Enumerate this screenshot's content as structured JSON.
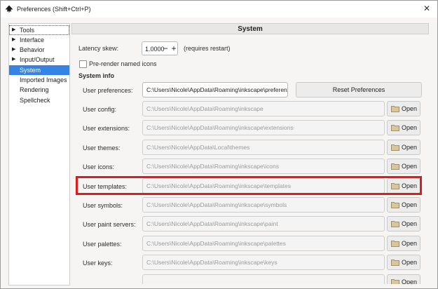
{
  "window": {
    "title": "Preferences (Shift+Ctrl+P)",
    "close": "✕"
  },
  "sidebar": {
    "items": [
      {
        "label": "Tools",
        "expandable": true
      },
      {
        "label": "Interface",
        "expandable": true
      },
      {
        "label": "Behavior",
        "expandable": true
      },
      {
        "label": "Input/Output",
        "expandable": true
      },
      {
        "label": "System",
        "expandable": false,
        "selected": true
      },
      {
        "label": "Imported Images",
        "expandable": false
      },
      {
        "label": "Rendering",
        "expandable": false
      },
      {
        "label": "Spellcheck",
        "expandable": false
      }
    ]
  },
  "panel": {
    "title": "System",
    "latency": {
      "label": "Latency skew:",
      "value": "1.0000",
      "minus": "−",
      "plus": "+",
      "note": "(requires restart)"
    },
    "prerender": {
      "label": "Pre-render named icons",
      "checked": false
    },
    "section_title": "System info",
    "user_preferences": {
      "label": "User preferences:",
      "value": "C:\\Users\\Nicole\\AppData\\Roaming\\inkscape\\preferen",
      "reset_label": "Reset Preferences"
    },
    "open_label": "Open",
    "rows": [
      {
        "label": "User config:",
        "value": "C:\\Users\\Nicole\\AppData\\Roaming\\inkscape"
      },
      {
        "label": "User extensions:",
        "value": "C:\\Users\\Nicole\\AppData\\Roaming\\inkscape\\extensions"
      },
      {
        "label": "User themes:",
        "value": "C:\\Users\\Nicole\\AppData\\Local\\themes"
      },
      {
        "label": "User icons:",
        "value": "C:\\Users\\Nicole\\AppData\\Roaming\\inkscape\\icons"
      },
      {
        "label": "User templates:",
        "value": "C:\\Users\\Nicole\\AppData\\Roaming\\inkscape\\templates"
      },
      {
        "label": "User symbols:",
        "value": "C:\\Users\\Nicole\\AppData\\Roaming\\inkscape\\symbols"
      },
      {
        "label": "User paint servers:",
        "value": "C:\\Users\\Nicole\\AppData\\Roaming\\inkscape\\paint"
      },
      {
        "label": "User palettes:",
        "value": "C:\\Users\\Nicole\\AppData\\Roaming\\inkscape\\palettes"
      },
      {
        "label": "User keys:",
        "value": "C:\\Users\\Nicole\\AppData\\Roaming\\inkscape\\keys"
      },
      {
        "label": "",
        "value": ""
      }
    ]
  },
  "colors": {
    "selection": "#3584e4",
    "highlight": "#e01b1b"
  }
}
